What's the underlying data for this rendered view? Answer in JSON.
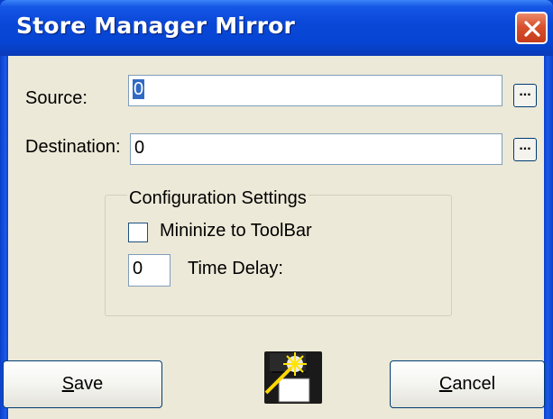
{
  "window": {
    "title": "Store Manager Mirror"
  },
  "form": {
    "source_label": "Source:",
    "source_value": "0",
    "destination_label": "Destination:",
    "destination_value": "0",
    "browse_label": "..."
  },
  "config": {
    "group_title": "Configuration Settings",
    "minimize_label": "Mininize to ToolBar",
    "minimize_checked": false,
    "delay_value": "0",
    "delay_label": "Time Delay:"
  },
  "buttons": {
    "save_first": "S",
    "save_rest": "ave",
    "cancel_first": "C",
    "cancel_rest": "ancel"
  },
  "icons": {
    "close": "close-icon",
    "save_disk": "floppy-disk-icon"
  },
  "colors": {
    "titlebar": "#0645d3",
    "client_bg": "#ece9d8",
    "close_button": "#d9512e"
  }
}
